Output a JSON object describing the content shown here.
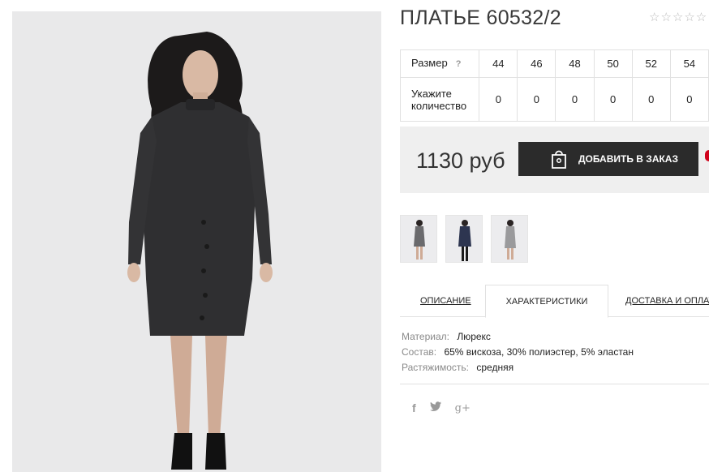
{
  "product": {
    "title": "ПЛАТЬЕ 60532/2",
    "rating_stars": "☆☆☆☆☆"
  },
  "sizes": {
    "size_label": "Размер",
    "help": "?",
    "qty_label": "Укажите количество",
    "values": [
      "44",
      "46",
      "48",
      "50",
      "52",
      "54"
    ],
    "quantities": [
      "0",
      "0",
      "0",
      "0",
      "0",
      "0"
    ]
  },
  "purchase": {
    "price": "1130 руб",
    "button_label": "ДОБАВИТЬ В ЗАКАЗ"
  },
  "tabs": {
    "description": "ОПИСАНИЕ",
    "characteristics": "ХАРАКТЕРИСТИКИ",
    "shipping": "ДОСТАВКА И ОПЛАТА"
  },
  "specs": [
    {
      "label": "Материал:",
      "value": "Люрекс"
    },
    {
      "label": "Состав:",
      "value": "65% вискоза, 30% полиэстер, 5% эластан"
    },
    {
      "label": "Растяжимость:",
      "value": "средняя"
    }
  ],
  "social": {
    "facebook": "f",
    "twitter": "🐦",
    "gplus": "g+"
  },
  "colors": {
    "button_bg": "#2b2b2b",
    "price_box_bg": "#efefef",
    "photo_bg": "#e9e9ea",
    "dress_dark": "#2f2f31",
    "dress_navy": "#2d3550",
    "dress_grey": "#8c8c8e"
  },
  "thumbnails": [
    {
      "name": "thumb-grey-dark",
      "dress_color": "#6a6a6d"
    },
    {
      "name": "thumb-navy",
      "dress_color": "#2d3550"
    },
    {
      "name": "thumb-light-grey",
      "dress_color": "#9a9a9c"
    }
  ]
}
